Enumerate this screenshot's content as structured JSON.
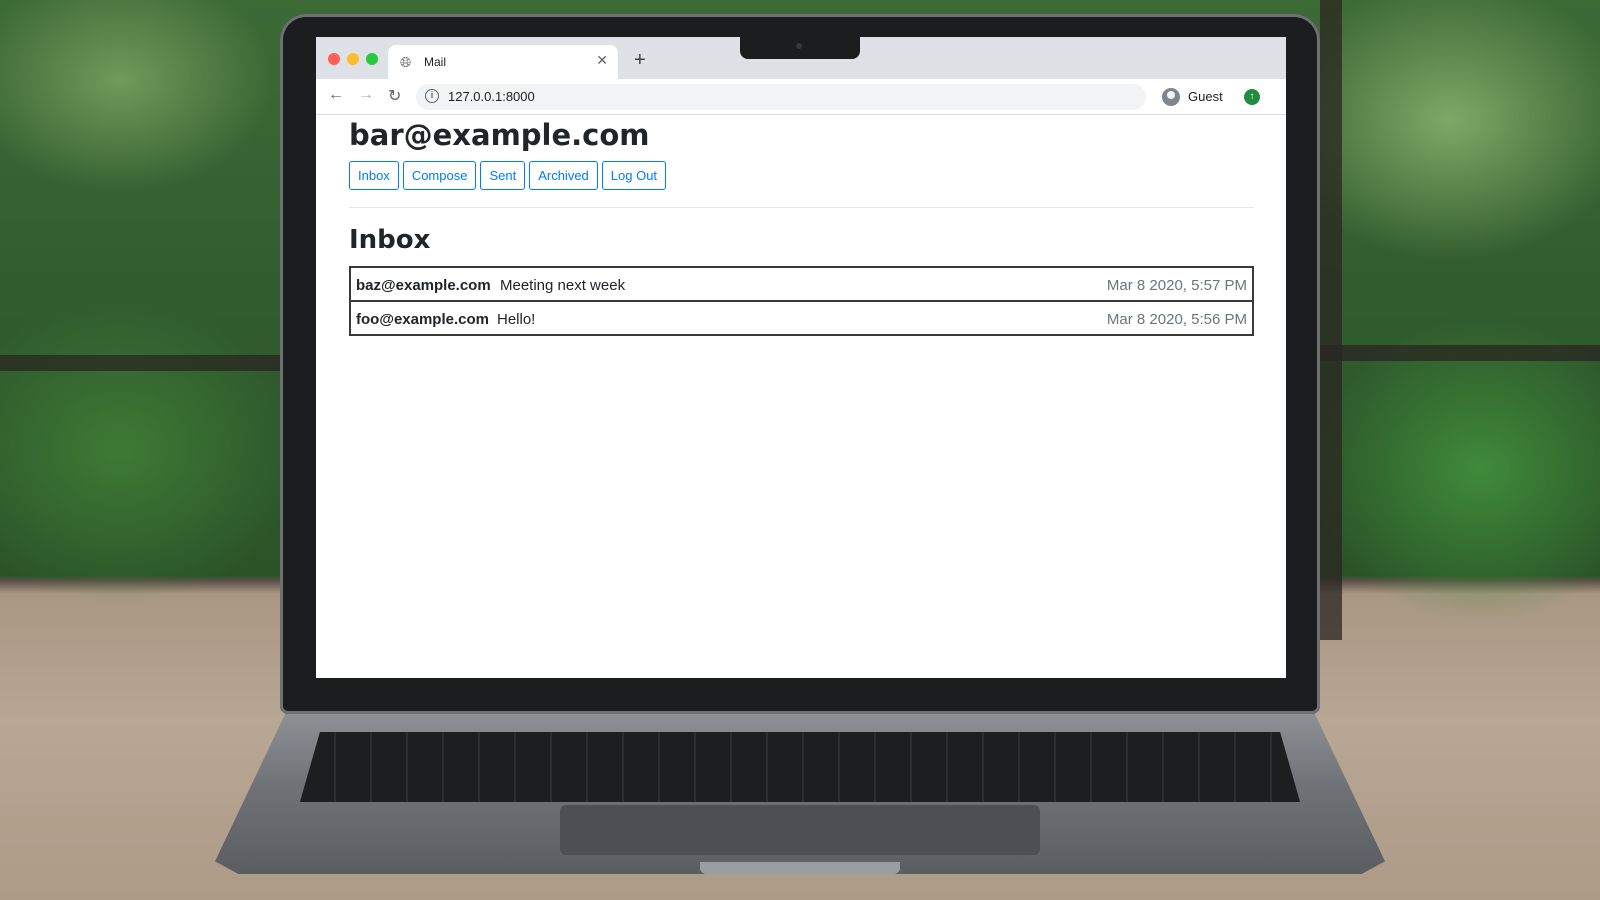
{
  "browser": {
    "tab_title": "Mail",
    "url": "127.0.0.1:8000",
    "profile_label": "Guest"
  },
  "page": {
    "user_email": "bar@example.com",
    "nav_buttons": [
      "Inbox",
      "Compose",
      "Sent",
      "Archived",
      "Log Out"
    ],
    "section_title": "Inbox"
  },
  "emails": [
    {
      "sender": "baz@example.com",
      "subject": "Meeting next week",
      "timestamp": "Mar 8 2020, 5:57 PM"
    },
    {
      "sender": "foo@example.com",
      "subject": "Hello!",
      "timestamp": "Mar 8 2020, 5:56 PM"
    }
  ],
  "colors": {
    "button_accent": "#007bff",
    "timestamp_gray": "#6c757d"
  }
}
